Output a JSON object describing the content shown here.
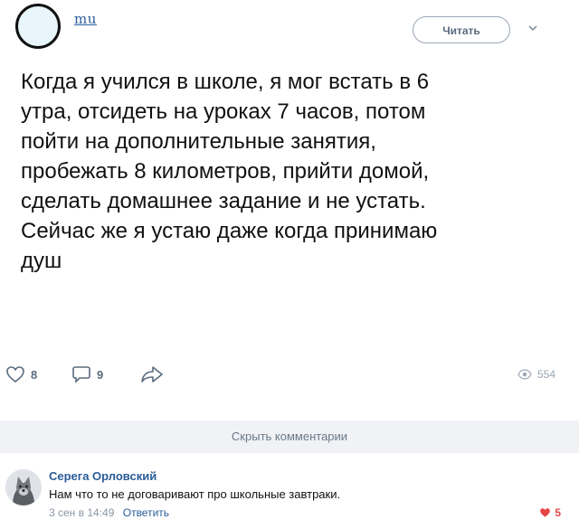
{
  "header": {
    "username": "mu",
    "follow_label": "Читать"
  },
  "tweet": {
    "text": "Когда я учился в школе, я мог встать в 6\nутра, отсидеть на уроках 7 часов, потом\nпойти на дополнительные занятия,\nпробежать 8 километров, прийти домой,\nсделать домашнее задание и не устать.\nСейчас же я устаю  даже когда принимаю\nдуш"
  },
  "actions": {
    "likes": "8",
    "comments": "9",
    "views": "554"
  },
  "comments_toggle": "Скрыть комментарии",
  "comment": {
    "author": "Серега Орловский",
    "text": "Нам что то не договаривают про школьные завтраки.",
    "time": "3 сен в 14:49",
    "reply_label": "Ответить",
    "likes": "5"
  },
  "colors": {
    "link": "#2a5c9a",
    "icon": "#5a6b7f",
    "like_active": "#e64646"
  }
}
